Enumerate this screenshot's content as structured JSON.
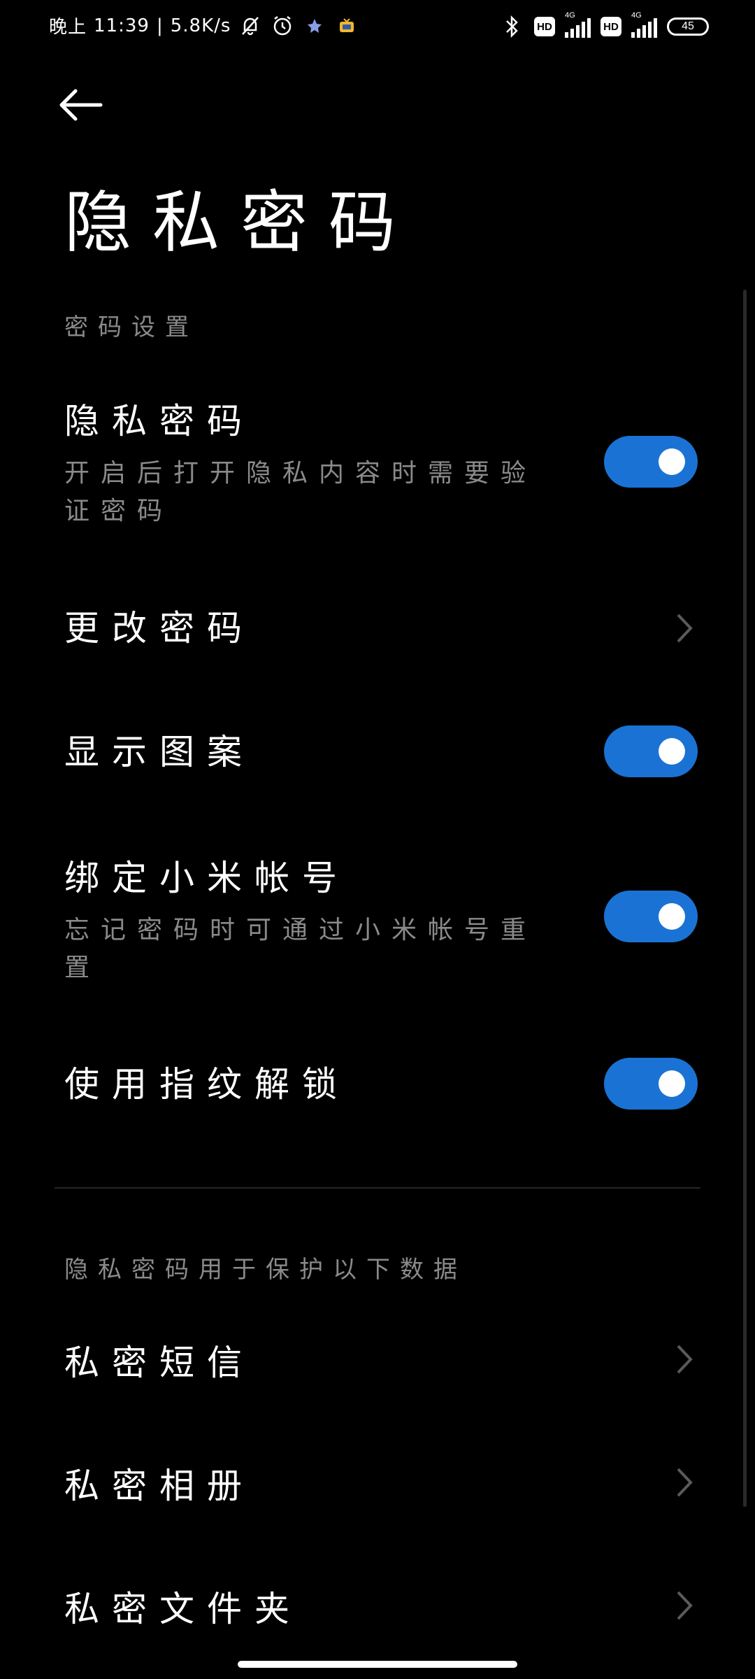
{
  "status_bar": {
    "period": "晚上",
    "time": "11:39",
    "speed": "5.8K/s",
    "network_tag": "4G",
    "battery": "45"
  },
  "header": {
    "title": "隐私密码"
  },
  "sections": {
    "password_settings": "密码设置",
    "protected_data": "隐私密码用于保护以下数据"
  },
  "rows": {
    "privacy_password": {
      "title": "隐私密码",
      "subtitle": "开启后打开隐私内容时需要验证密码",
      "enabled": true
    },
    "change_password": {
      "title": "更改密码"
    },
    "show_pattern": {
      "title": "显示图案",
      "enabled": true
    },
    "bind_mi_account": {
      "title": "绑定小米帐号",
      "subtitle": "忘记密码时可通过小米帐号重置",
      "enabled": true
    },
    "fingerprint_unlock": {
      "title": "使用指纹解锁",
      "enabled": true
    },
    "private_sms": {
      "title": "私密短信"
    },
    "private_album": {
      "title": "私密相册"
    },
    "private_folder": {
      "title": "私密文件夹"
    }
  },
  "colors": {
    "background": "#000000",
    "toggle_on": "#1a73d4",
    "secondary_text": "#8a8a8a"
  }
}
